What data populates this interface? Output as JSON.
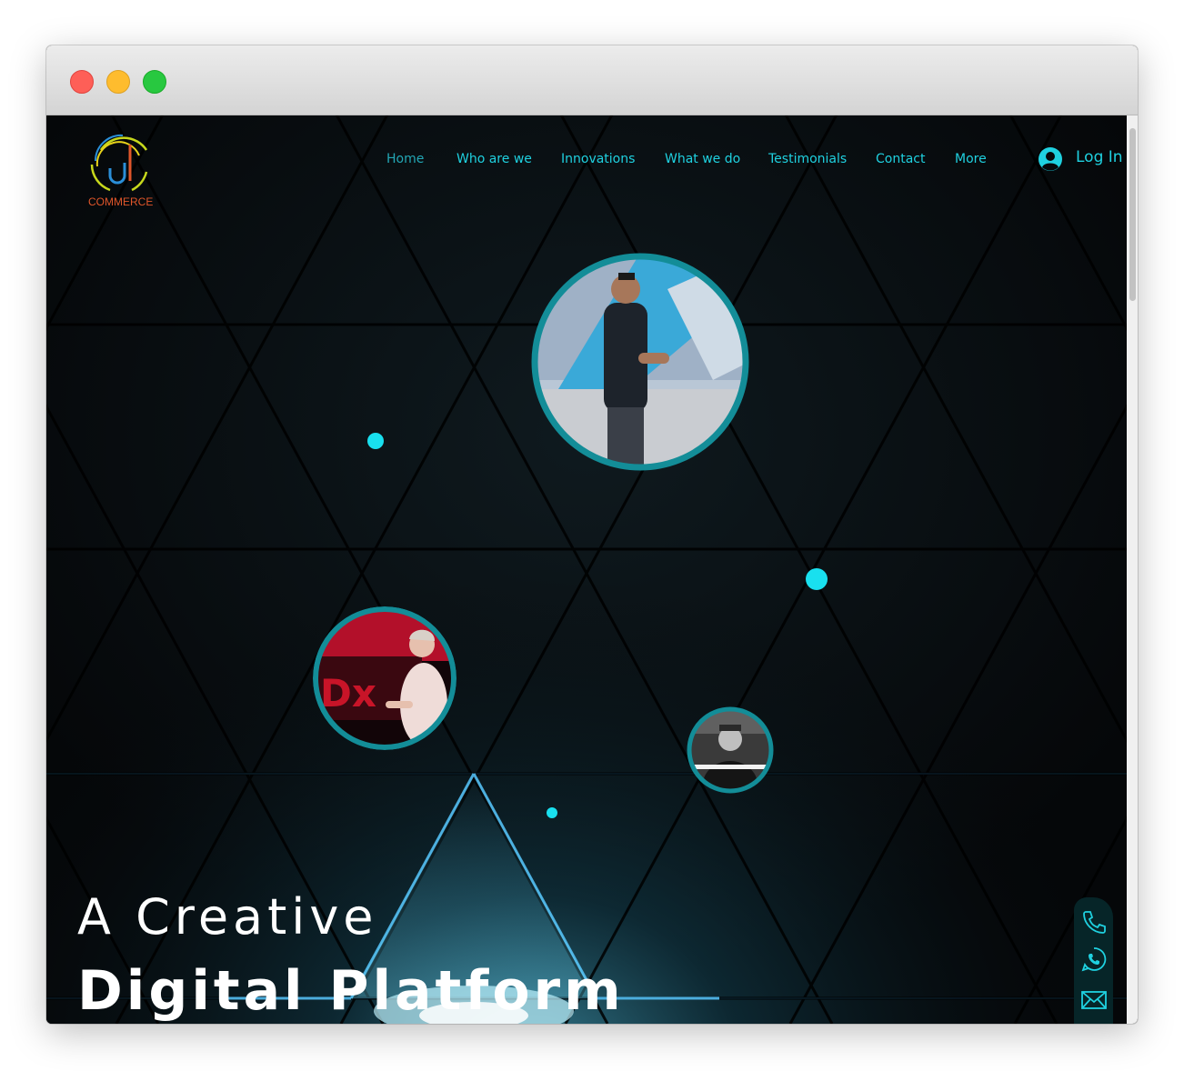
{
  "logo": {
    "text": "COMMERCE"
  },
  "nav": {
    "items": [
      {
        "label": "Home",
        "active": true
      },
      {
        "label": "Who are we",
        "active": false
      },
      {
        "label": "Innovations",
        "active": false
      },
      {
        "label": "What we do",
        "active": false
      },
      {
        "label": "Testimonials",
        "active": false
      },
      {
        "label": "Contact",
        "active": false
      },
      {
        "label": "More",
        "active": false
      }
    ]
  },
  "login": {
    "label": "Log In"
  },
  "hero": {
    "headline_line1": "A Creative",
    "headline_line2": "Digital Platform"
  },
  "contact_bar": {
    "icons": [
      "phone-icon",
      "whatsapp-icon",
      "mail-icon"
    ]
  },
  "colors": {
    "accent": "#1fd1e0",
    "active_nav": "#23a7b5",
    "bubble_ring": "#138d98",
    "background": "#06090b"
  }
}
